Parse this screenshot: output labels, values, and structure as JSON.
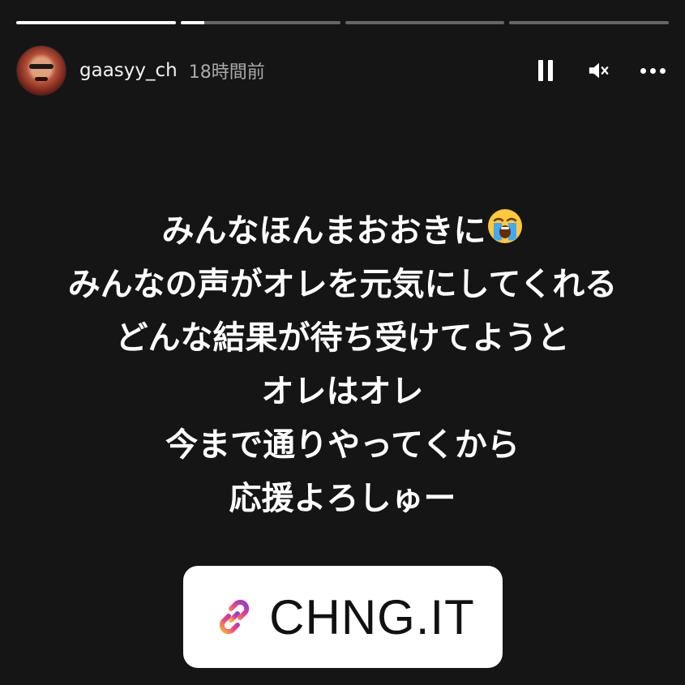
{
  "progress": [
    {
      "label": "story-1",
      "value": 1.0
    },
    {
      "label": "story-2",
      "value": 0.15
    },
    {
      "label": "story-3",
      "value": 0.0
    },
    {
      "label": "story-4",
      "value": 0.0
    }
  ],
  "header": {
    "username": "gaasyy_ch",
    "timestamp": "18時間前",
    "avatar_icon": "profile-avatar",
    "controls": [
      "pause-icon",
      "mute-icon",
      "more-icon"
    ]
  },
  "story": {
    "lines": [
      "みんなほんまおおきに",
      "みんなの声がオレを元気にしてくれる",
      "どんな結果が待ち受けてようと",
      "オレはオレ",
      "今まで通りやってくから",
      "応援よろしゅー"
    ],
    "emoji": "loudly-crying-face-emoji"
  },
  "link_sticker": {
    "label": "CHNG.IT",
    "icon": "link-icon"
  },
  "colors": {
    "background": "#151515",
    "text": "#ffffff",
    "link_gradient": [
      "#f9b233",
      "#e83e8c",
      "#8b3fd9"
    ]
  }
}
